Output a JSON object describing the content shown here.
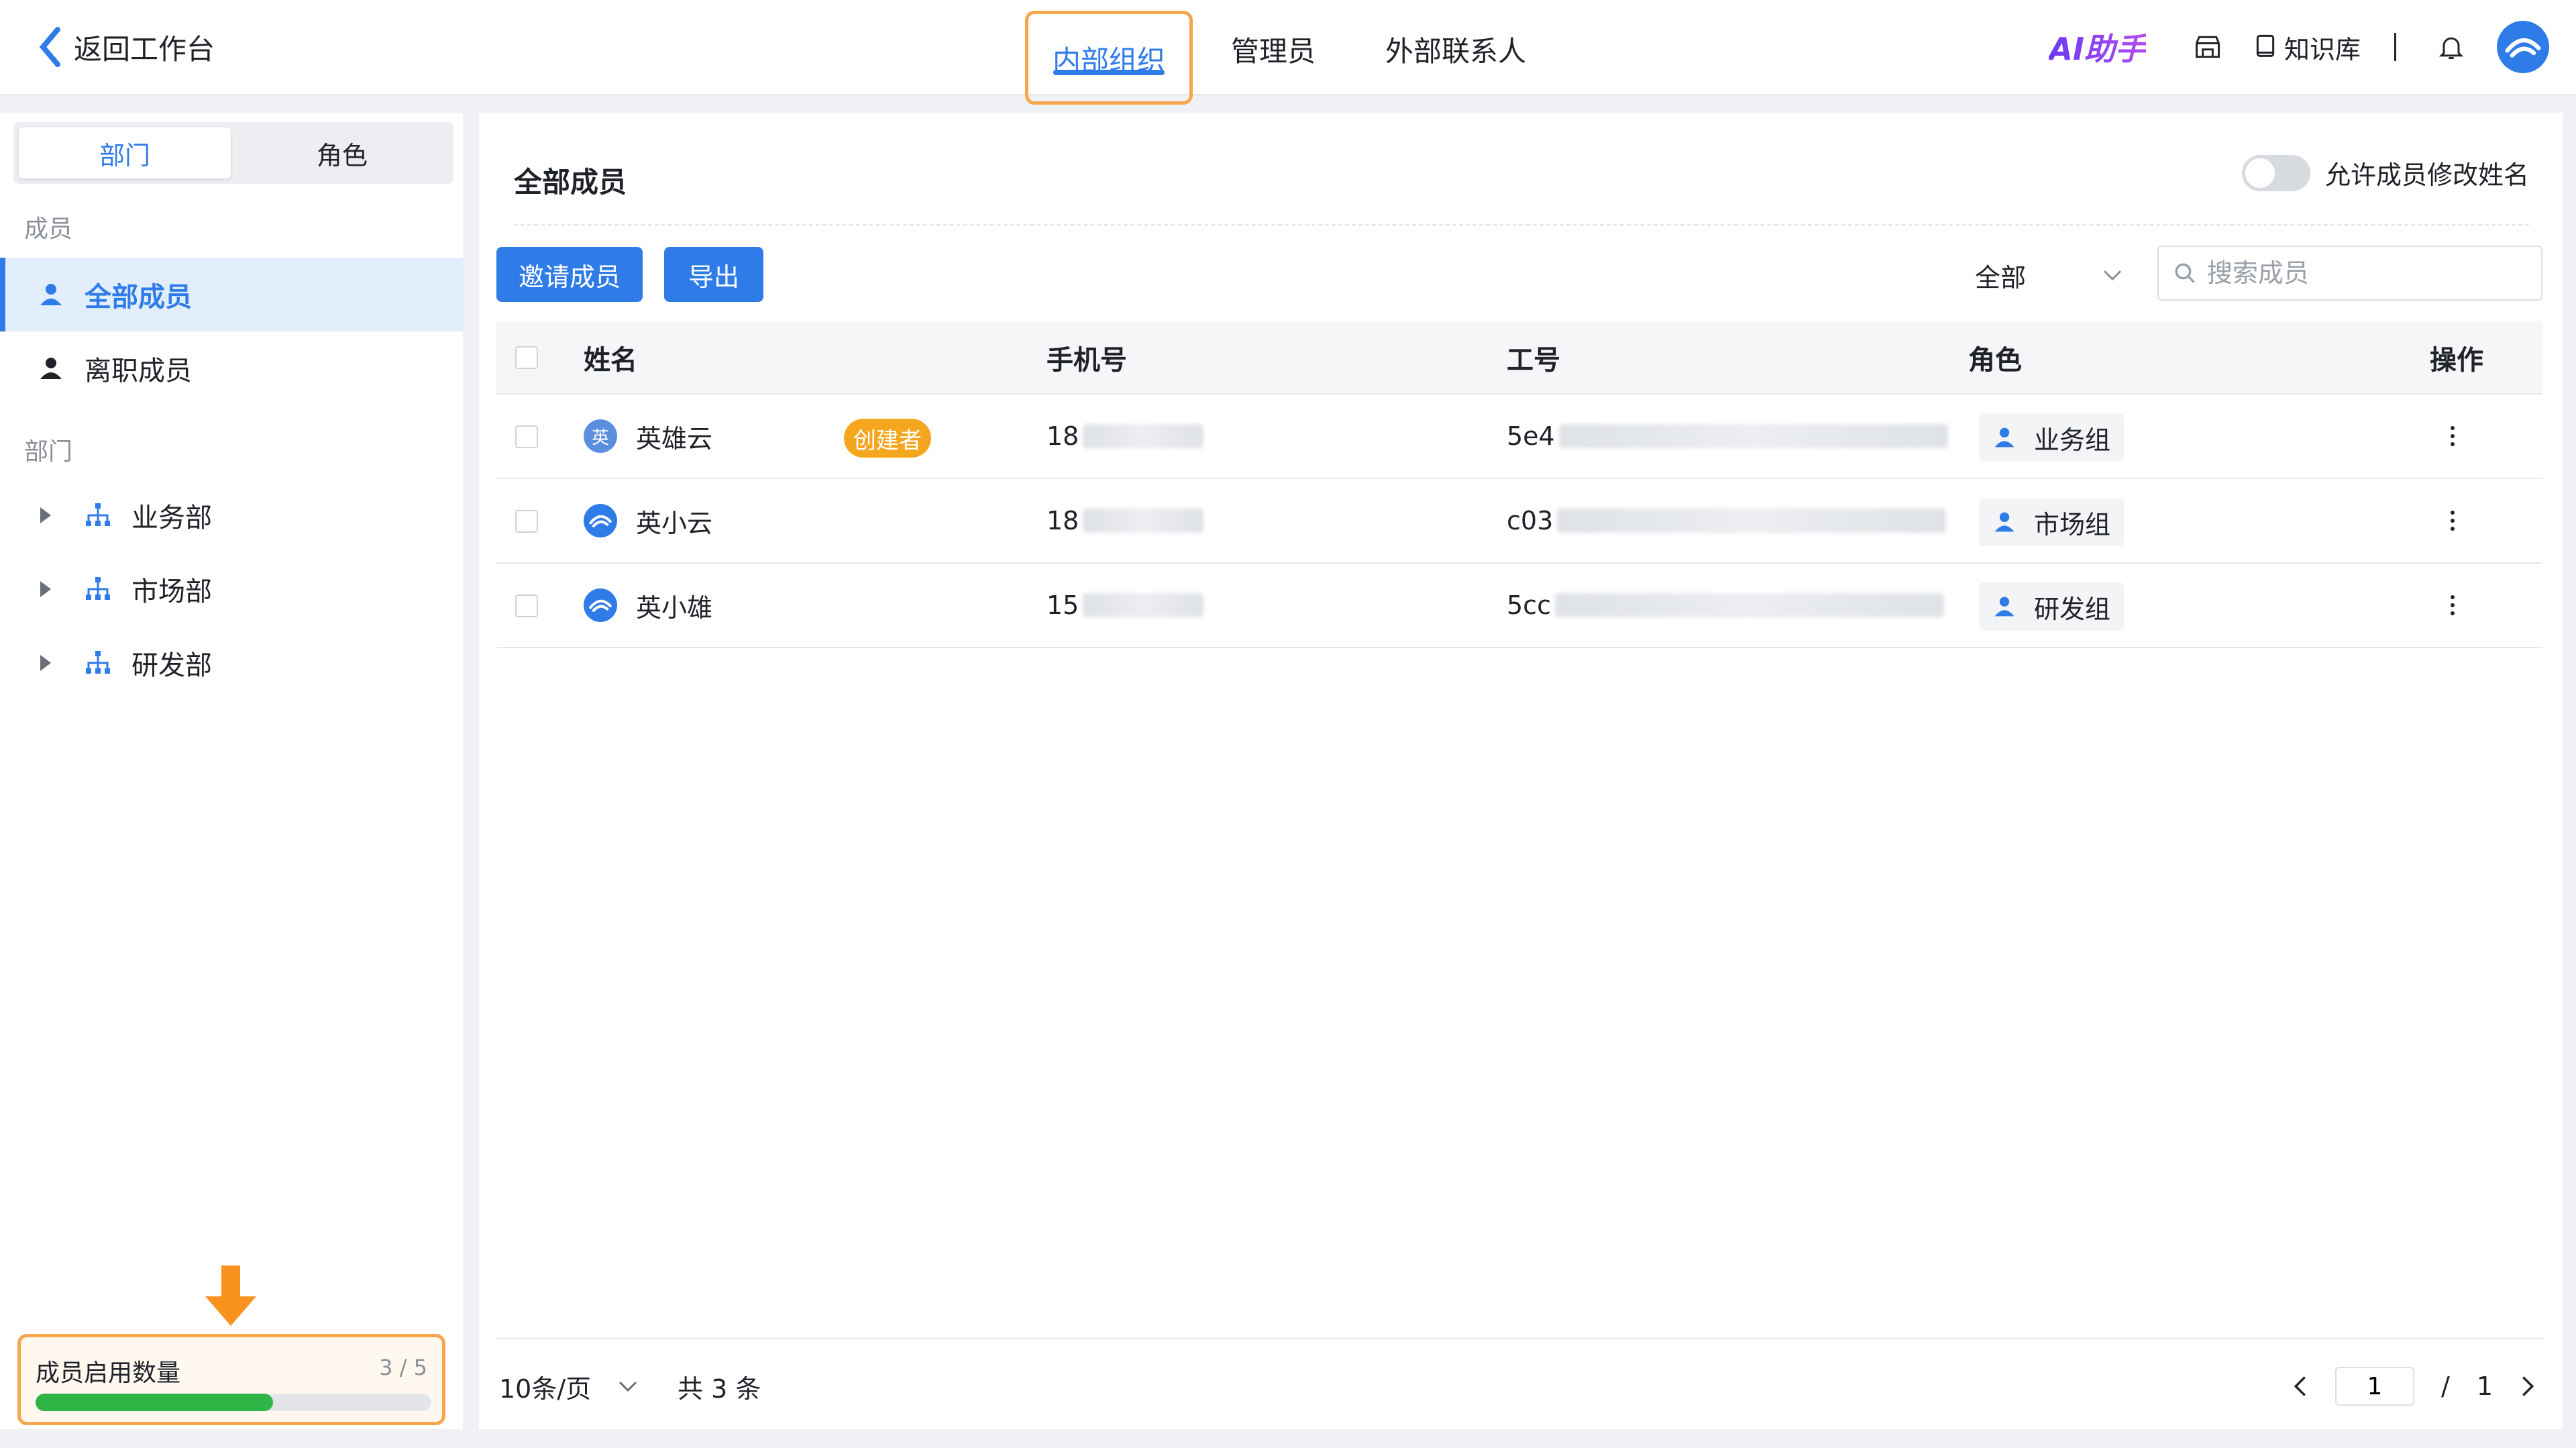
{
  "header": {
    "back_label": "返回工作台",
    "tabs": [
      {
        "label": "内部组织",
        "active": true
      },
      {
        "label": "管理员",
        "active": false
      },
      {
        "label": "外部联系人",
        "active": false
      }
    ],
    "ai_label": "AI助手",
    "knowledge_label": "知识库"
  },
  "sidebar": {
    "segment": [
      {
        "label": "部门",
        "active": true
      },
      {
        "label": "角色",
        "active": false
      }
    ],
    "members_section": "成员",
    "member_items": [
      {
        "label": "全部成员",
        "active": true
      },
      {
        "label": "离职成员",
        "active": false
      }
    ],
    "dept_section": "部门",
    "departments": [
      {
        "label": "业务部"
      },
      {
        "label": "市场部"
      },
      {
        "label": "研发部"
      }
    ],
    "quota": {
      "label": "成员启用数量",
      "count": "3 / 5",
      "fraction": 0.6
    }
  },
  "main": {
    "title": "全部成员",
    "toggle_label": "允许成员修改姓名",
    "invite_label": "邀请成员",
    "export_label": "导出",
    "filter_value": "全部",
    "search_placeholder": "搜索成员",
    "columns": {
      "name": "姓名",
      "phone": "手机号",
      "job_no": "工号",
      "role": "角色",
      "action": "操作"
    },
    "rows": [
      {
        "avatar_char": "英",
        "name": "英雄云",
        "badge": "创建者",
        "phone_prefix": "18",
        "job_prefix": "5e4",
        "role": "业务组"
      },
      {
        "avatar_char": "",
        "name": "英小云",
        "badge": "",
        "phone_prefix": "18",
        "job_prefix": "c03",
        "role": "市场组"
      },
      {
        "avatar_char": "",
        "name": "英小雄",
        "badge": "",
        "phone_prefix": "15",
        "job_prefix": "5cc",
        "role": "研发组"
      }
    ],
    "pagination": {
      "page_size": "10条/页",
      "total": "共 3 条",
      "current": "1",
      "separator": "/",
      "pages": "1"
    }
  },
  "colors": {
    "primary": "#2f7ce8",
    "highlight": "#f7a64b",
    "badge": "#f5a61f",
    "progress": "#2fb545"
  }
}
